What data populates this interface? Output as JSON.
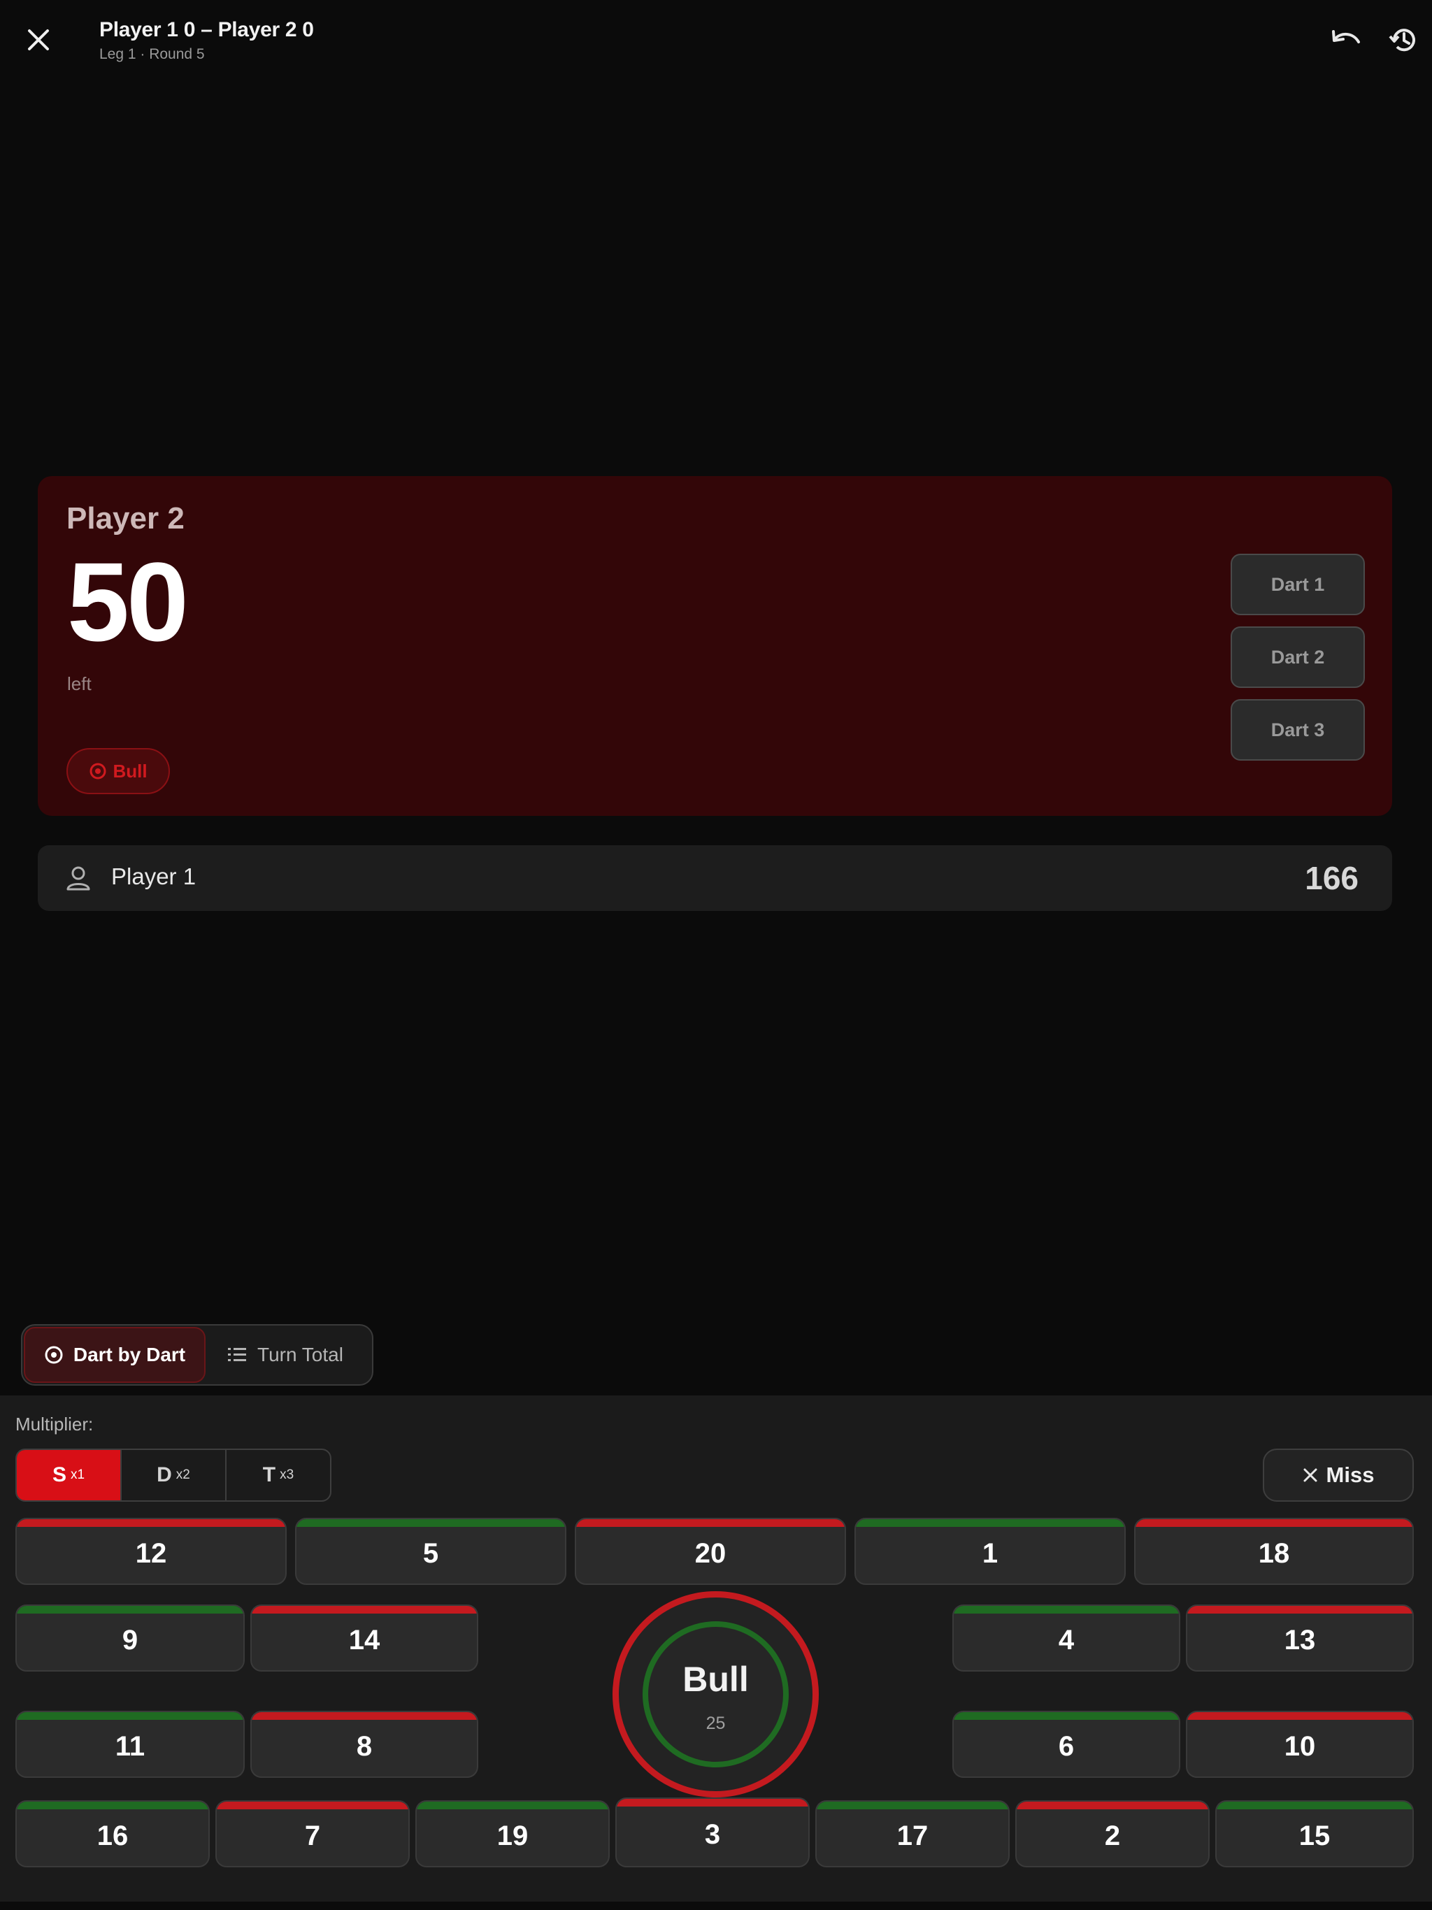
{
  "header": {
    "title": "Player 1 0 – Player 2 0",
    "subtitle": "Leg 1 · Round 5"
  },
  "active_player": {
    "name": "Player 2",
    "score": "50",
    "score_caption": "left",
    "suggestion": "Bull",
    "darts": [
      "Dart 1",
      "Dart 2",
      "Dart 3"
    ]
  },
  "other_player": {
    "name": "Player 1",
    "score": "166"
  },
  "input_mode": {
    "active": "Dart by Dart",
    "inactive": "Turn Total"
  },
  "keypad": {
    "multiplier_label": "Multiplier:",
    "multipliers": [
      {
        "letter": "S",
        "factor": "x1"
      },
      {
        "letter": "D",
        "factor": "x2"
      },
      {
        "letter": "T",
        "factor": "x3"
      }
    ],
    "selected_multiplier": "S",
    "miss_label": "Miss",
    "bull_label": "Bull",
    "bull_value": "25",
    "rows": [
      [
        "12",
        "5",
        "20",
        "1",
        "18"
      ],
      [
        "9",
        "14",
        "4",
        "13"
      ],
      [
        "11",
        "8",
        "6",
        "10"
      ],
      [
        "16",
        "7",
        "19",
        "3",
        "17",
        "2",
        "15"
      ]
    ]
  },
  "colors": {
    "accent_red": "#d80f16",
    "board_red": "#c41a1f",
    "board_green": "#1f6b22",
    "active_card": "#330608"
  }
}
